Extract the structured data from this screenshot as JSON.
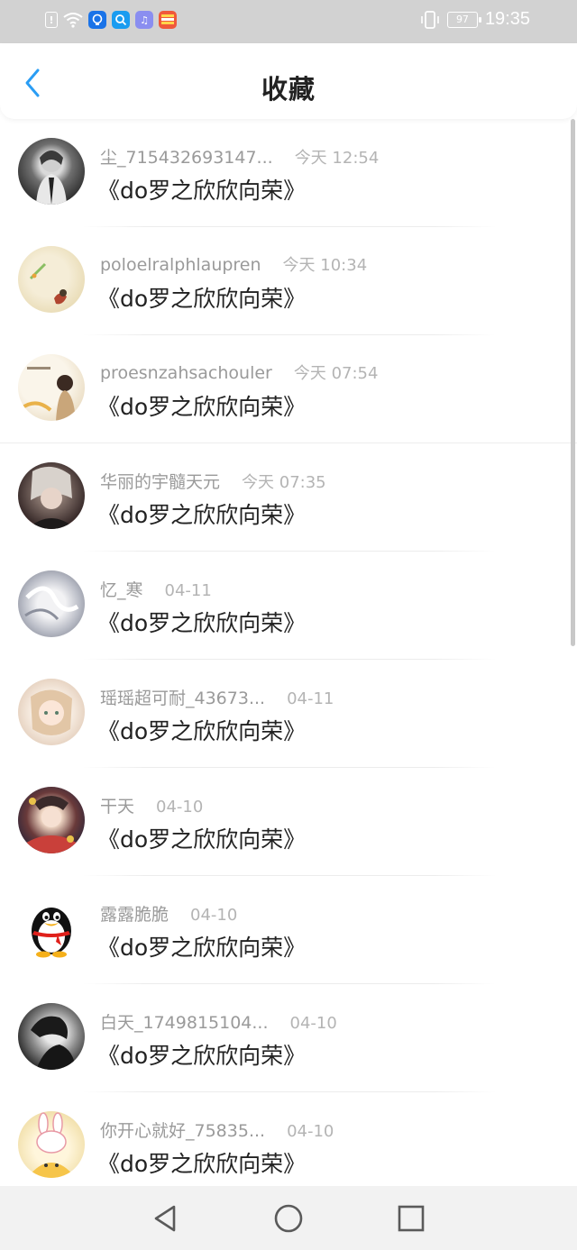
{
  "status_bar": {
    "time": "19:35",
    "battery": "97",
    "icons": [
      "notification-icon",
      "wifi-icon",
      "app-icon-blue",
      "search-app-icon",
      "music-app-icon",
      "gallery-app-icon",
      "vibrate-icon"
    ]
  },
  "header": {
    "title": "收藏",
    "back_icon": "chevron-left-icon",
    "accent_color": "#2a9df4"
  },
  "favorites": [
    {
      "user": "尘_715432693147...",
      "time": "今天 12:54",
      "content": "《do罗之欣欣向荣》"
    },
    {
      "user": "poloelralphlaupren",
      "time": "今天 10:34",
      "content": "《do罗之欣欣向荣》"
    },
    {
      "user": "proesnzahsachouler",
      "time": "今天 07:54",
      "content": "《do罗之欣欣向荣》"
    },
    {
      "user": "华丽的宇髓天元",
      "time": "今天 07:35",
      "content": "《do罗之欣欣向荣》"
    },
    {
      "user": "忆_寒",
      "time": "04-11",
      "content": "《do罗之欣欣向荣》"
    },
    {
      "user": "瑶瑶超可耐_43673...",
      "time": "04-11",
      "content": "《do罗之欣欣向荣》"
    },
    {
      "user": "干天",
      "time": "04-10",
      "content": "《do罗之欣欣向荣》"
    },
    {
      "user": "露露脆脆",
      "time": "04-10",
      "content": "《do罗之欣欣向荣》"
    },
    {
      "user": "白天_1749815104...",
      "time": "04-10",
      "content": "《do罗之欣欣向荣》"
    },
    {
      "user": "你开心就好_75835...",
      "time": "04-10",
      "content": "《do罗之欣欣向荣》"
    }
  ],
  "navbar": {
    "icons": [
      "back-triangle-icon",
      "home-circle-icon",
      "recents-square-icon"
    ]
  }
}
